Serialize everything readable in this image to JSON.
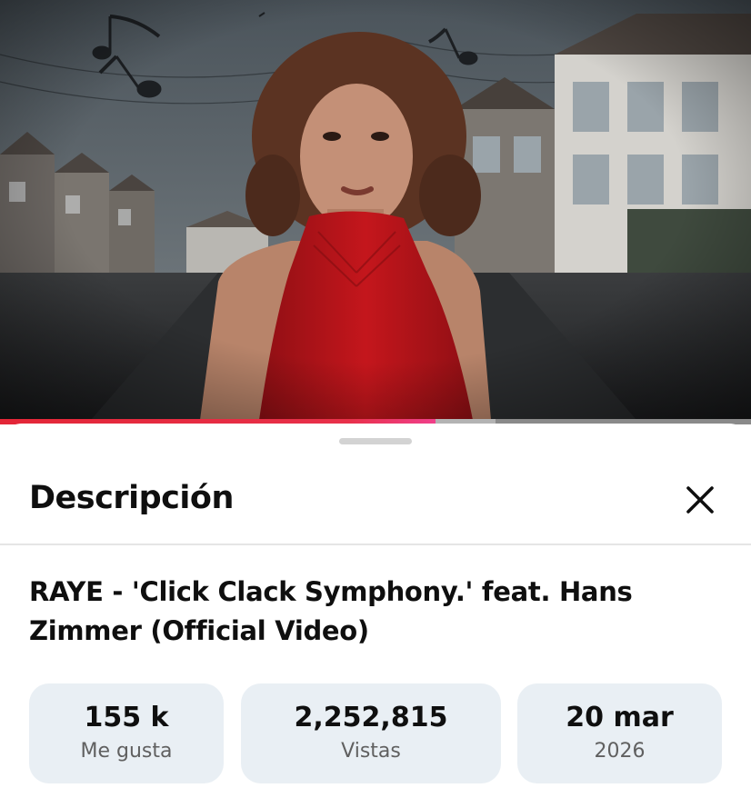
{
  "player": {
    "progress": 0.58,
    "buffered": 0.66,
    "colors": {
      "played": "#e32637",
      "buffered": "#b3b3b3",
      "track": "#8a8a8a"
    }
  },
  "sheet": {
    "title": "Descripción",
    "close_icon": "close-icon"
  },
  "video": {
    "title": "RAYE - 'Click Clack Symphony.' feat. Hans Zimmer (Official Video)"
  },
  "stats": [
    {
      "value": "155 k",
      "label": "Me gusta"
    },
    {
      "value": "2,252,815",
      "label": "Vistas"
    },
    {
      "value": "20 mar",
      "label": "2026"
    }
  ],
  "colors": {
    "stat_background": "#e9eff4",
    "text_primary": "#0f0f0f",
    "text_secondary": "#606060",
    "dress": "#c4161c"
  }
}
